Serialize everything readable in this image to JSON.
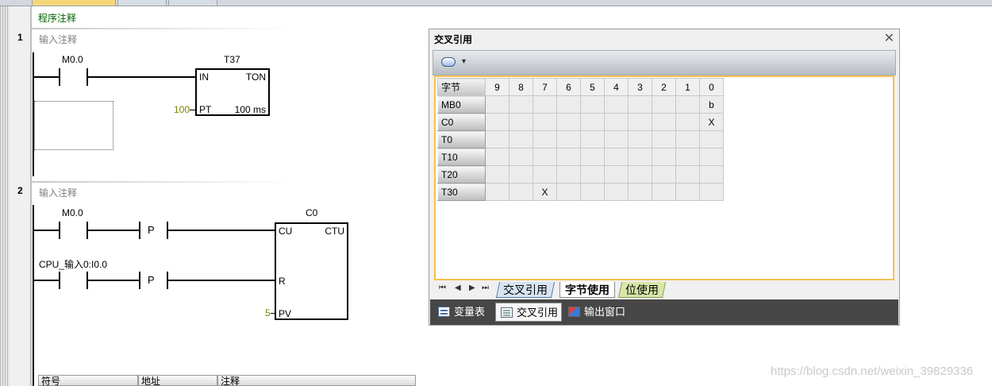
{
  "editor": {
    "program_comment": "程序注释",
    "networks": [
      {
        "number": "1",
        "comment": "输入注释",
        "contact": "M0.0",
        "timer": {
          "name": "T37",
          "type": "TON",
          "in_pin": "IN",
          "pt_pin": "PT",
          "pt_value": "100",
          "resolution": "100 ms"
        }
      },
      {
        "number": "2",
        "comment": "输入注释",
        "contact1": "M0.0",
        "contact2": "CPU_输入0:I0.0",
        "pulse_label": "P",
        "counter": {
          "name": "C0",
          "type": "CTU",
          "cu_pin": "CU",
          "r_pin": "R",
          "pv_pin": "PV",
          "pv_value": "5"
        }
      }
    ],
    "symbol_table_headers": [
      "符号",
      "地址",
      "注释"
    ]
  },
  "cross_reference": {
    "title": "交叉引用",
    "close_glyph": "✕",
    "toolbar_arrow": "▼",
    "table": {
      "corner": "字节",
      "columns": [
        "9",
        "8",
        "7",
        "6",
        "5",
        "4",
        "3",
        "2",
        "1",
        "0"
      ],
      "rows": [
        {
          "label": "MB0",
          "cells": [
            "",
            "",
            "",
            "",
            "",
            "",
            "",
            "",
            "",
            "b"
          ]
        },
        {
          "label": "C0",
          "cells": [
            "",
            "",
            "",
            "",
            "",
            "",
            "",
            "",
            "",
            "X"
          ]
        },
        {
          "label": "T0",
          "cells": [
            "",
            "",
            "",
            "",
            "",
            "",
            "",
            "",
            "",
            ""
          ]
        },
        {
          "label": "T10",
          "cells": [
            "",
            "",
            "",
            "",
            "",
            "",
            "",
            "",
            "",
            ""
          ]
        },
        {
          "label": "T20",
          "cells": [
            "",
            "",
            "",
            "",
            "",
            "",
            "",
            "",
            "",
            ""
          ]
        },
        {
          "label": "T30",
          "cells": [
            "",
            "",
            "X",
            "",
            "",
            "",
            "",
            "",
            "",
            ""
          ]
        }
      ]
    },
    "nav_glyphs": [
      "⏮",
      "◀",
      "▶",
      "⏭"
    ],
    "sub_tabs": [
      "交叉引用",
      "字节使用",
      "位使用"
    ],
    "active_sub_tab": "字节使用"
  },
  "dock": {
    "items": [
      {
        "label": "变量表",
        "icon": "variable-table-icon"
      },
      {
        "label": "交叉引用",
        "icon": "cross-reference-icon"
      },
      {
        "label": "输出窗口",
        "icon": "output-window-icon"
      }
    ],
    "active": "交叉引用"
  },
  "watermark": "https://blog.csdn.net/weixin_39829336"
}
